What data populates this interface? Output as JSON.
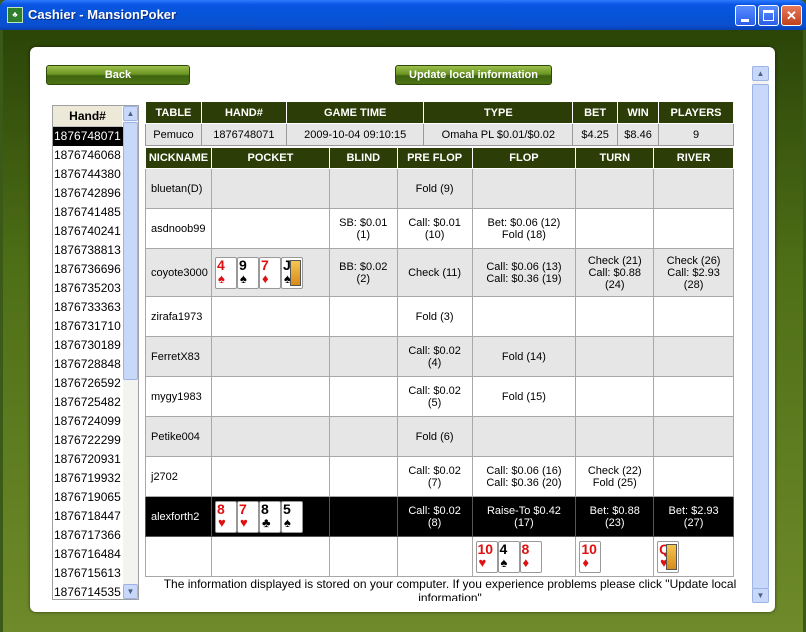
{
  "window": {
    "title": "Cashier - MansionPoker",
    "icon": "app-icon"
  },
  "buttons": {
    "back": "Back",
    "update": "Update local information"
  },
  "hand_list": {
    "header": "Hand#",
    "items": [
      "1876748071",
      "1876746068",
      "1876744380",
      "1876742896",
      "1876741485",
      "1876740241",
      "1876738813",
      "1876736696",
      "1876735203",
      "1876733363",
      "1876731710",
      "1876730189",
      "1876728848",
      "1876726592",
      "1876725482",
      "1876724099",
      "1876722299",
      "1876720931",
      "1876719932",
      "1876719065",
      "1876718447",
      "1876717366",
      "1876716484",
      "1876715613",
      "1876714535"
    ],
    "selected_index": 0
  },
  "summary": {
    "headers": [
      "TABLE",
      "HAND#",
      "GAME TIME",
      "TYPE",
      "BET",
      "WIN",
      "PLAYERS"
    ],
    "values": [
      "Pemuco",
      "1876748071",
      "2009-10-04 09:10:15",
      "Omaha PL $0.01/$0.02",
      "$4.25",
      "$8.46",
      "9"
    ]
  },
  "actions": {
    "headers": [
      "NICKNAME",
      "POCKET",
      "BLIND",
      "PRE FLOP",
      "FLOP",
      "TURN",
      "RIVER"
    ],
    "rows": [
      {
        "nickname": "bluetan(D)",
        "blind": "",
        "preflop": "Fold (9)",
        "flop": "",
        "turn": "",
        "river": ""
      },
      {
        "nickname": "asdnoob99",
        "blind": "SB: $0.01\n(1)",
        "preflop": "Call: $0.01\n(10)",
        "flop": "Bet: $0.06 (12)\nFold (18)",
        "turn": "",
        "river": ""
      },
      {
        "nickname": "coyote3000",
        "blind": "BB: $0.02\n(2)",
        "preflop": "Check (11)",
        "flop": "Call: $0.06 (13)\nCall: $0.36 (19)",
        "turn": "Check (21)\nCall: $0.88\n(24)",
        "river": "Check (26)\nCall: $2.93\n(28)"
      },
      {
        "nickname": "zirafa1973",
        "blind": "",
        "preflop": "Fold (3)",
        "flop": "",
        "turn": "",
        "river": ""
      },
      {
        "nickname": "FerretX83",
        "blind": "",
        "preflop": "Call: $0.02\n(4)",
        "flop": "Fold (14)",
        "turn": "",
        "river": ""
      },
      {
        "nickname": "mygy1983",
        "blind": "",
        "preflop": "Call: $0.02\n(5)",
        "flop": "Fold (15)",
        "turn": "",
        "river": ""
      },
      {
        "nickname": "Petike004",
        "blind": "",
        "preflop": "Fold (6)",
        "flop": "",
        "turn": "",
        "river": ""
      },
      {
        "nickname": "j2702",
        "blind": "",
        "preflop": "Call: $0.02\n(7)",
        "flop": "Call: $0.06 (16)\nCall: $0.36 (20)",
        "turn": "Check (22)\nFold (25)",
        "river": ""
      },
      {
        "nickname": "alexforth2",
        "blind": "",
        "preflop": "Call: $0.02\n(8)",
        "flop": "Raise-To $0.42\n(17)",
        "turn": "Bet: $0.88\n(23)",
        "river": "Bet: $2.93\n(27)"
      }
    ],
    "pocket_coyote": [
      {
        "rank": "4",
        "suit": "♠",
        "color": "red"
      },
      {
        "rank": "9",
        "suit": "♠",
        "color": "black"
      },
      {
        "rank": "7",
        "suit": "♦",
        "color": "red"
      },
      {
        "rank": "J",
        "suit": "♠",
        "color": "black"
      }
    ],
    "pocket_alex": [
      {
        "rank": "8",
        "suit": "♥",
        "color": "red"
      },
      {
        "rank": "7",
        "suit": "♥",
        "color": "red"
      },
      {
        "rank": "8",
        "suit": "♣",
        "color": "black"
      },
      {
        "rank": "5",
        "suit": "♠",
        "color": "black"
      }
    ],
    "board_flop": [
      {
        "rank": "10",
        "suit": "♥",
        "color": "red"
      },
      {
        "rank": "4",
        "suit": "♠",
        "color": "black"
      },
      {
        "rank": "8",
        "suit": "♦",
        "color": "red"
      }
    ],
    "board_turn": [
      {
        "rank": "10",
        "suit": "♦",
        "color": "red"
      }
    ],
    "board_river": [
      {
        "rank": "Q",
        "suit": "♥",
        "color": "red"
      }
    ]
  },
  "info": "The information displayed is stored on your computer. If you experience problems please click \"Update local information\"",
  "colors": {
    "header_bg": "#2c3d07",
    "button_green": "#6b9523",
    "frame_green": "#4f6f17",
    "title_blue": "#0654d8"
  }
}
